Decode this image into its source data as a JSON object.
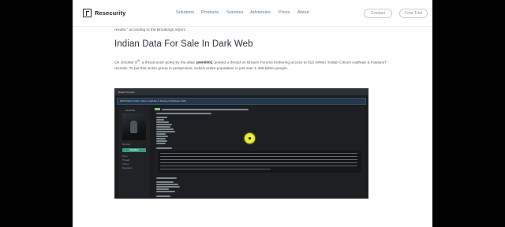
{
  "nav": {
    "brand": "Resecurity",
    "links": [
      "Solutions",
      "Products",
      "Services",
      "Advisories",
      "Press",
      "About"
    ],
    "contact_label": "Contact",
    "trial_label": "Free Trial"
  },
  "article": {
    "intro_fragment": "results,” according to the Brookings report.",
    "heading": "Indian Data For Sale In Dark Web",
    "para_part1": "On October 9",
    "para_sup": "th",
    "para_part2": ", a threat actor going by the alias ‘",
    "para_alias": "pwn0001",
    "para_part3": "’ posted a thread on Breach Forums brokering access to 815 million “Indian Citizen Aadhaar & Passport” records. To put this victim group in perspective, India’s entire population is just over 1.486 billion people."
  },
  "screenshot": {
    "window_title": "Breach Forums",
    "thread_title": "[815 Million] Indian Citizen Aadhaar & Passport Database 2023",
    "username": "pwn0001",
    "rank": "Member",
    "badge": "MEMBER",
    "stats": [
      "Posts",
      "Threads",
      "Joined",
      "Reputation"
    ],
    "accent_color": "#e9ef2a"
  }
}
